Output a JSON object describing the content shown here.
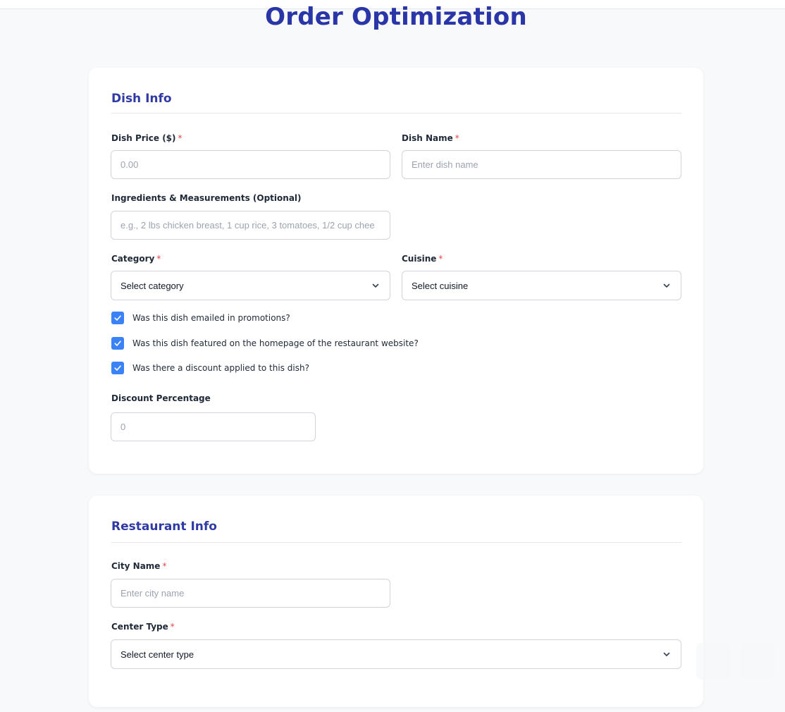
{
  "page": {
    "title": "Order Optimization"
  },
  "dish_info": {
    "section_title": "Dish Info",
    "dish_price": {
      "label": "Dish Price ($)",
      "required_mark": "*",
      "placeholder": "0.00",
      "value": ""
    },
    "dish_name": {
      "label": "Dish Name",
      "required_mark": "*",
      "placeholder": "Enter dish name",
      "value": ""
    },
    "ingredients": {
      "label": "Ingredients & Measurements (Optional)",
      "placeholder": "e.g., 2 lbs chicken breast, 1 cup rice, 3 tomatoes, 1/2 cup chee",
      "value": ""
    },
    "category": {
      "label": "Category",
      "required_mark": "*",
      "selected": "Select category"
    },
    "cuisine": {
      "label": "Cuisine",
      "required_mark": "*",
      "selected": "Select cuisine"
    },
    "checkboxes": [
      {
        "label": "Was this dish emailed in promotions?",
        "checked": true
      },
      {
        "label": "Was this dish featured on the homepage of the restaurant website?",
        "checked": true
      },
      {
        "label": "Was there a discount applied to this dish?",
        "checked": true
      }
    ],
    "discount_percentage": {
      "label": "Discount Percentage",
      "placeholder": "0",
      "value": ""
    }
  },
  "restaurant_info": {
    "section_title": "Restaurant Info",
    "city_name": {
      "label": "City Name",
      "required_mark": "*",
      "placeholder": "Enter city name",
      "value": ""
    },
    "center_type": {
      "label": "Center Type",
      "required_mark": "*",
      "selected": "Select center type"
    }
  },
  "colors": {
    "title": "#2a35a8",
    "section_title": "#2f3aa5",
    "required": "#ef4444",
    "checkbox": "#3b82f6",
    "page_background": "#f8f9fb"
  },
  "icons": {
    "select_arrow": "chevron-down-icon",
    "checkbox_mark": "check-icon"
  }
}
